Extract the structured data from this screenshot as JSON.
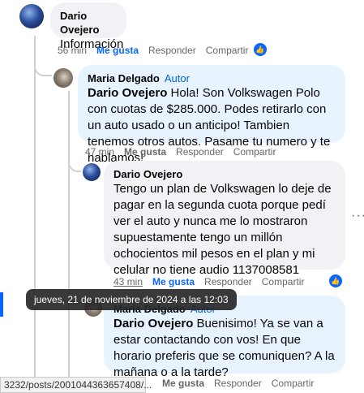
{
  "comments": [
    {
      "author": "Dario Ovejero",
      "badge": "",
      "text": "Información",
      "mention": "",
      "time": "56 min",
      "like": "Me gusta",
      "reply": "Responder",
      "share": "Compartir"
    },
    {
      "author": "Maria Delgado",
      "badge": "Autor",
      "mention": "Dario Ovejero",
      "text": " Hola! Son Volkswagen Polo con cuotas de $285.000. Podes retirarlo con un auto usado o un anticipo! Tambien tenemos otros autos. Pasame tu numero y te hablamos!",
      "time": "47 min",
      "like": "Me gusta",
      "reply": "Responder",
      "share": "Compartir"
    },
    {
      "author": "Dario Ovejero",
      "badge": "",
      "mention": "",
      "text": "Tengo un plan de Volkswagen lo deje de pagar en la segunda cuota porque pedí ver el auto y nunca me lo mostraron supuestamente tengo un millón ochocientos mil pesos en el plan y mi celular no tiene audio 1137008581",
      "time": "43 min",
      "like": "Me gusta",
      "reply": "Responder",
      "share": "Compartir"
    },
    {
      "author": "Maria Delgado",
      "badge": "Autor",
      "mention": "Dario Ovejero",
      "text": " Buenisimo! Ya se van a estar contactando con vos! En que horario preferis que se comuniquen? A la mañana o a la tarde?",
      "time": "",
      "like": "Me gusta",
      "reply": "Responder",
      "share": "Compartir"
    }
  ],
  "tooltip": "jueves, 21 de noviembre de 2024 a las 12:03",
  "status_url": "3232/posts/2001044363657408/...",
  "more_label": "···",
  "like_icon": "👍",
  "colors": {
    "accent": "#0866ff",
    "bubble_grey": "#f0f2f5",
    "bubble_blue": "#e7f3ff"
  }
}
